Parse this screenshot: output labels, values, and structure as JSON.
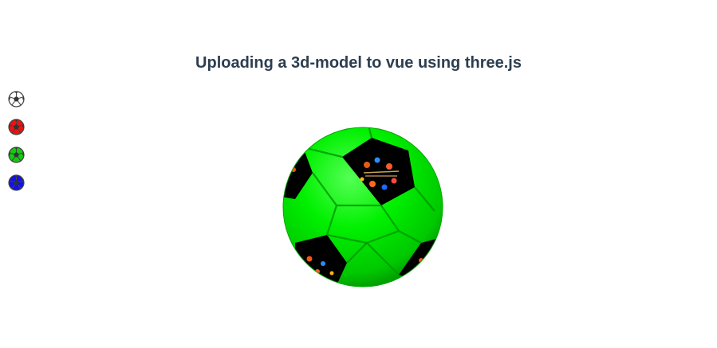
{
  "header": {
    "title": "Uploading a 3d-model to vue using three.js"
  },
  "color_picker": {
    "options": [
      {
        "name": "white",
        "fill": "#ffffff",
        "patch": "#333333"
      },
      {
        "name": "red",
        "fill": "#ff0000",
        "patch": "#333333"
      },
      {
        "name": "green",
        "fill": "#00cc00",
        "patch": "#333333"
      },
      {
        "name": "blue",
        "fill": "#0000ff",
        "patch": "#333333"
      }
    ],
    "selected": "green"
  },
  "model": {
    "panel_color": "#00ee00",
    "patch_color": "#000000",
    "icon": "soccer-ball-icon"
  }
}
